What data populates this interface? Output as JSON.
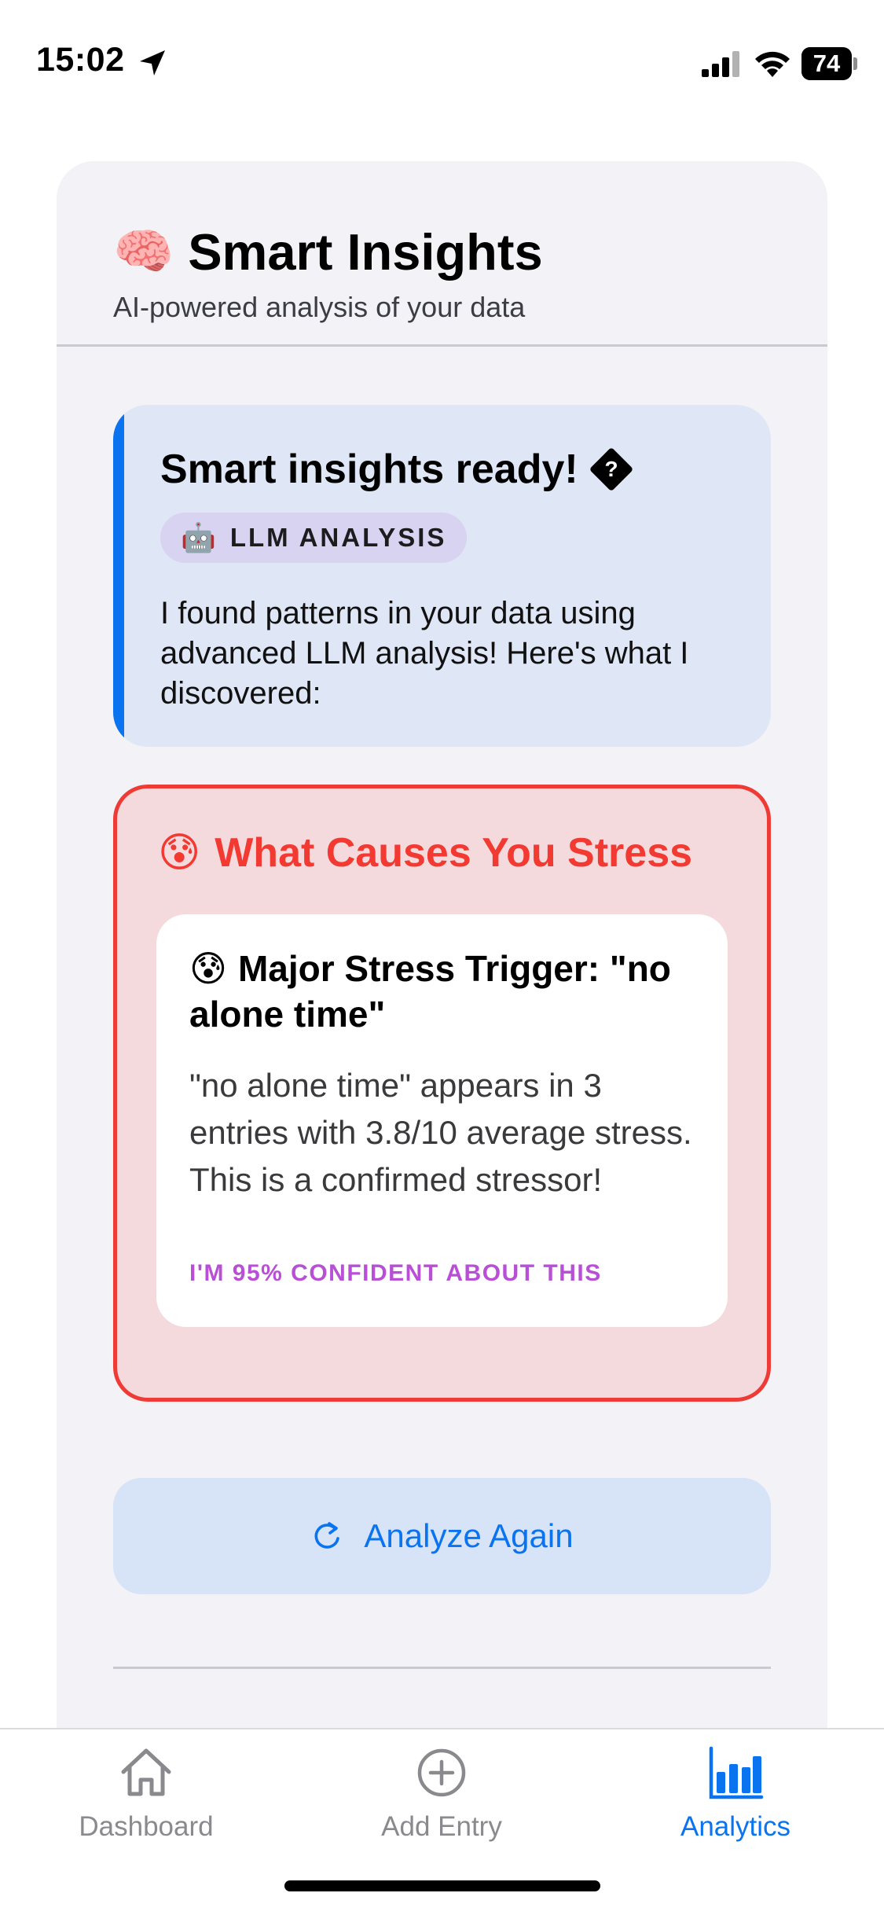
{
  "status_bar": {
    "time": "15:02",
    "battery": "74",
    "battery_level": 0.74
  },
  "card": {
    "icon": "🧠",
    "title": "Smart Insights",
    "subtitle": "AI-powered analysis of your data"
  },
  "ready": {
    "title": "Smart insights ready!",
    "unknown_glyph": "?",
    "badge_icon": "🤖",
    "badge_label": "LLM ANALYSIS",
    "description": "I found patterns in your data using advanced LLM analysis! Here's what I discovered:"
  },
  "stress": {
    "icon": "😰",
    "title": "What Causes You Stress",
    "trigger": {
      "icon": "😰",
      "title": "Major Stress Trigger: \"no alone time\"",
      "description": "\"no alone time\" appears in 3 entries with 3.8/10 average stress. This is a confirmed stressor!",
      "confidence": "I'M 95% CONFIDENT ABOUT THIS"
    }
  },
  "actions": {
    "analyze_again": "Analyze Again"
  },
  "tab_bar": {
    "tabs": [
      {
        "label": "Dashboard",
        "icon": "house-icon",
        "active": false
      },
      {
        "label": "Add Entry",
        "icon": "plus-circle-icon",
        "active": false
      },
      {
        "label": "Analytics",
        "icon": "bar-chart-icon",
        "active": true
      }
    ]
  },
  "colors": {
    "accent": "#0a74f0",
    "stress_red": "#f23a32",
    "confidence_purple": "#b84fd6"
  }
}
